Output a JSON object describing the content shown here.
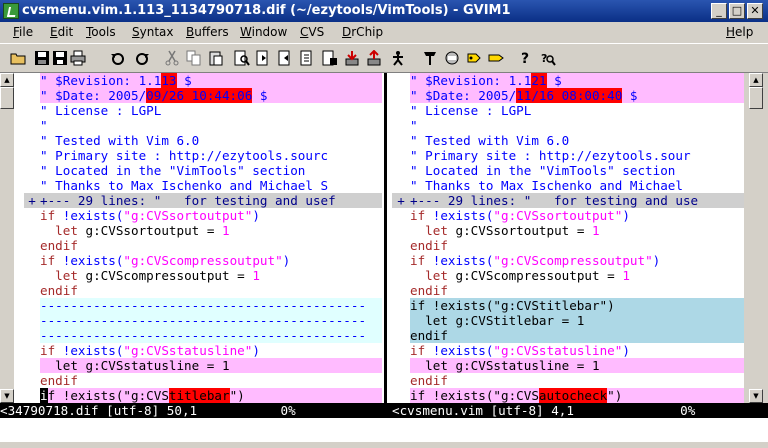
{
  "window": {
    "title": "cvsmenu.vim.1.113_1134790718.dif (~/ezytools/VimTools) - GVIM1",
    "buttons": [
      "_",
      "□",
      "✕"
    ]
  },
  "menubar": {
    "items": [
      {
        "label": "File",
        "underline": "F",
        "rest": "ile"
      },
      {
        "label": "Edit",
        "underline": "E",
        "rest": "dit"
      },
      {
        "label": "Tools",
        "underline": "T",
        "rest": "ools"
      },
      {
        "label": "Syntax",
        "underline": "S",
        "rest": "yntax"
      },
      {
        "label": "Buffers",
        "underline": "B",
        "rest": "uffers"
      },
      {
        "label": "Window",
        "underline": "W",
        "rest": "indow"
      },
      {
        "label": "CVS",
        "underline": "C",
        "rest": "VS"
      },
      {
        "label": "DrChip",
        "underline": "D",
        "rest": "rChip"
      },
      {
        "label": "Help",
        "underline": "H",
        "rest": "elp"
      }
    ]
  },
  "toolbar": {
    "icons": [
      "open-icon",
      "save-icon",
      "save-all-icon",
      "print-icon",
      "undo-icon",
      "redo-icon",
      "cut-icon",
      "copy-icon",
      "paste-icon",
      "find-icon",
      "find-next-icon",
      "find-prev-icon",
      "load-session-icon",
      "save-session-icon",
      "run-script-icon",
      "make-icon",
      "shell-icon",
      "tags-icon",
      "help-tag-icon",
      "find-help-icon"
    ]
  },
  "left_pane": {
    "lines": [
      {
        "bg": "pink",
        "parts": [
          {
            "t": "\" $Revision: 1.1",
            "c": "com"
          },
          {
            "t": "13",
            "c": "com",
            "diff": true
          },
          {
            "t": " $",
            "c": "com"
          }
        ]
      },
      {
        "bg": "pink",
        "parts": [
          {
            "t": "\" $Date: 2005/",
            "c": "com"
          },
          {
            "t": "09/26 10:44:06",
            "c": "com",
            "diff": true
          },
          {
            "t": " $",
            "c": "com"
          }
        ]
      },
      {
        "bg": "",
        "parts": [
          {
            "t": "\" License : LGPL",
            "c": "com"
          }
        ]
      },
      {
        "bg": "",
        "parts": [
          {
            "t": "\"",
            "c": "com"
          }
        ]
      },
      {
        "bg": "",
        "parts": [
          {
            "t": "\" Tested with Vim 6.0",
            "c": "com"
          }
        ]
      },
      {
        "bg": "",
        "parts": [
          {
            "t": "\" Primary site : http://ezytools.sourc",
            "c": "com"
          }
        ]
      },
      {
        "bg": "",
        "parts": [
          {
            "t": "\" Located in the \"VimTools\" section",
            "c": "com"
          }
        ]
      },
      {
        "bg": "",
        "parts": [
          {
            "t": "\" Thanks to Max Ischenko and Michael S",
            "c": "com"
          }
        ]
      },
      {
        "bg": "fold",
        "parts": [
          {
            "t": "+--- 29 lines: \"   for testing and usef",
            "c": "fold"
          }
        ]
      },
      {
        "bg": "",
        "parts": [
          {
            "t": "if ",
            "c": "kw"
          },
          {
            "t": "!exists(",
            "c": "com"
          },
          {
            "t": "\"g:CVSsortoutput\"",
            "c": "str"
          },
          {
            "t": ")",
            "c": "com"
          }
        ]
      },
      {
        "bg": "",
        "parts": [
          {
            "t": "  let ",
            "c": "kw"
          },
          {
            "t": "g:CVSsortoutput = ",
            "c": ""
          },
          {
            "t": "1",
            "c": "num"
          }
        ]
      },
      {
        "bg": "",
        "parts": [
          {
            "t": "endif",
            "c": "kw"
          }
        ]
      },
      {
        "bg": "",
        "parts": [
          {
            "t": "if ",
            "c": "kw"
          },
          {
            "t": "!exists(",
            "c": "com"
          },
          {
            "t": "\"g:CVScompressoutput\"",
            "c": "str"
          },
          {
            "t": ")",
            "c": "com"
          }
        ]
      },
      {
        "bg": "",
        "parts": [
          {
            "t": "  let ",
            "c": "kw"
          },
          {
            "t": "g:CVScompressoutput = ",
            "c": ""
          },
          {
            "t": "1",
            "c": "num"
          }
        ]
      },
      {
        "bg": "",
        "parts": [
          {
            "t": "endif",
            "c": "kw"
          }
        ]
      },
      {
        "bg": "cyan",
        "parts": [
          {
            "t": "-------------------------------------------",
            "c": "fill"
          }
        ]
      },
      {
        "bg": "cyan",
        "parts": [
          {
            "t": "-------------------------------------------",
            "c": "fill"
          }
        ]
      },
      {
        "bg": "cyan",
        "parts": [
          {
            "t": "-------------------------------------------",
            "c": "fill"
          }
        ]
      },
      {
        "bg": "",
        "parts": [
          {
            "t": "if ",
            "c": "kw"
          },
          {
            "t": "!exists(",
            "c": "com"
          },
          {
            "t": "\"g:CVSstatusline\"",
            "c": "str"
          },
          {
            "t": ")",
            "c": "com"
          }
        ]
      },
      {
        "bg": "pink",
        "parts": [
          {
            "t": "  let g:CVSstatusline = 1",
            "c": ""
          }
        ]
      },
      {
        "bg": "",
        "parts": [
          {
            "t": "endif",
            "c": "kw"
          }
        ]
      },
      {
        "bg": "pink",
        "parts": [
          {
            "t": "i",
            "c": "",
            "cursor": true
          },
          {
            "t": "f !exists(\"g:CVS",
            "c": ""
          },
          {
            "t": "titlebar",
            "c": "",
            "diff": true
          },
          {
            "t": "\")",
            "c": ""
          }
        ]
      }
    ]
  },
  "right_pane": {
    "lines": [
      {
        "bg": "pink",
        "parts": [
          {
            "t": "\" $Revision: 1.1",
            "c": "com"
          },
          {
            "t": "21",
            "c": "com",
            "diff": true
          },
          {
            "t": " $",
            "c": "com"
          }
        ]
      },
      {
        "bg": "pink",
        "parts": [
          {
            "t": "\" $Date: 2005/",
            "c": "com"
          },
          {
            "t": "11/16 08:00:40",
            "c": "com",
            "diff": true
          },
          {
            "t": " $",
            "c": "com"
          }
        ]
      },
      {
        "bg": "",
        "parts": [
          {
            "t": "\" License : LGPL",
            "c": "com"
          }
        ]
      },
      {
        "bg": "",
        "parts": [
          {
            "t": "\"",
            "c": "com"
          }
        ]
      },
      {
        "bg": "",
        "parts": [
          {
            "t": "\" Tested with Vim 6.0",
            "c": "com"
          }
        ]
      },
      {
        "bg": "",
        "parts": [
          {
            "t": "\" Primary site : http://ezytools.sour",
            "c": "com"
          }
        ]
      },
      {
        "bg": "",
        "parts": [
          {
            "t": "\" Located in the \"VimTools\" section",
            "c": "com"
          }
        ]
      },
      {
        "bg": "",
        "parts": [
          {
            "t": "\" Thanks to Max Ischenko and Michael",
            "c": "com"
          }
        ]
      },
      {
        "bg": "fold",
        "parts": [
          {
            "t": "+--- 29 lines: \"   for testing and use",
            "c": "fold"
          }
        ]
      },
      {
        "bg": "",
        "parts": [
          {
            "t": "if ",
            "c": "kw"
          },
          {
            "t": "!exists(",
            "c": "com"
          },
          {
            "t": "\"g:CVSsortoutput\"",
            "c": "str"
          },
          {
            "t": ")",
            "c": "com"
          }
        ]
      },
      {
        "bg": "",
        "parts": [
          {
            "t": "  let ",
            "c": "kw"
          },
          {
            "t": "g:CVSsortoutput = ",
            "c": ""
          },
          {
            "t": "1",
            "c": "num"
          }
        ]
      },
      {
        "bg": "",
        "parts": [
          {
            "t": "endif",
            "c": "kw"
          }
        ]
      },
      {
        "bg": "",
        "parts": [
          {
            "t": "if ",
            "c": "kw"
          },
          {
            "t": "!exists(",
            "c": "com"
          },
          {
            "t": "\"g:CVScompressoutput\"",
            "c": "str"
          },
          {
            "t": ")",
            "c": "com"
          }
        ]
      },
      {
        "bg": "",
        "parts": [
          {
            "t": "  let ",
            "c": "kw"
          },
          {
            "t": "g:CVScompressoutput = ",
            "c": ""
          },
          {
            "t": "1",
            "c": "num"
          }
        ]
      },
      {
        "bg": "",
        "parts": [
          {
            "t": "endif",
            "c": "kw"
          }
        ]
      },
      {
        "bg": "blue",
        "parts": [
          {
            "t": "if !exists(\"g:CVStitlebar\")",
            "c": ""
          }
        ]
      },
      {
        "bg": "blue",
        "parts": [
          {
            "t": "  let g:CVStitlebar = 1",
            "c": ""
          }
        ]
      },
      {
        "bg": "blue",
        "parts": [
          {
            "t": "endif",
            "c": ""
          }
        ]
      },
      {
        "bg": "",
        "parts": [
          {
            "t": "if ",
            "c": "kw"
          },
          {
            "t": "!exists(",
            "c": "com"
          },
          {
            "t": "\"g:CVSstatusline\"",
            "c": "str"
          },
          {
            "t": ")",
            "c": "com"
          }
        ]
      },
      {
        "bg": "pink",
        "parts": [
          {
            "t": "  let g:CVSstatusline = 1",
            "c": ""
          }
        ]
      },
      {
        "bg": "",
        "parts": [
          {
            "t": "endif",
            "c": "kw"
          }
        ]
      },
      {
        "bg": "pink",
        "parts": [
          {
            "t": "if !exists(\"g:CVS",
            "c": ""
          },
          {
            "t": "autocheck",
            "c": "",
            "diff": true
          },
          {
            "t": "\")",
            "c": ""
          }
        ]
      }
    ]
  },
  "statusbar": {
    "left": "<34790718.dif [utf-8] 50,1           0%",
    "right": "<cvsmenu.vim [utf-8] 4,1              0%"
  },
  "colors": {
    "diff_change": "#ffbbff",
    "diff_text": "#ff0000",
    "diff_add": "#add8e6",
    "diff_delete": "#e0ffff",
    "fold": "#cfcfcf"
  }
}
